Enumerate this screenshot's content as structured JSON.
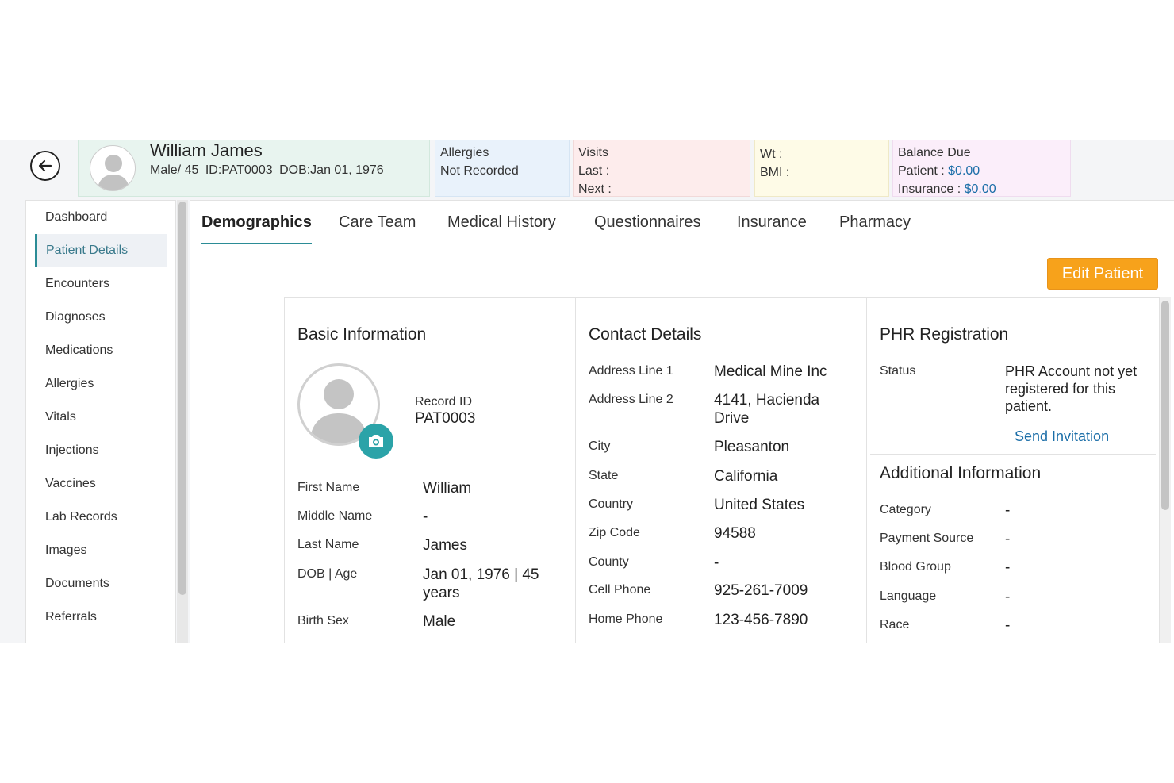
{
  "header": {
    "patient_name": "William James",
    "patient_meta": [
      "Male/ 45",
      "ID:PAT0003",
      "DOB:Jan 01, 1976"
    ],
    "allergies_label": "Allergies",
    "allergies_value": "Not Recorded",
    "visits_label": "Visits",
    "visits_last": "Last  :",
    "visits_next": "Next :",
    "wt": "Wt   :",
    "bmi": "BMI  :",
    "balance_label": "Balance Due",
    "patient_balance_label": "Patient :",
    "patient_balance_value": "$0.00",
    "insurance_balance_label": "Insurance :",
    "insurance_balance_value": "$0.00"
  },
  "sidebar": {
    "items": [
      {
        "label": "Dashboard",
        "active": false
      },
      {
        "label": "Patient Details",
        "active": true
      },
      {
        "label": "Encounters",
        "active": false
      },
      {
        "label": "Diagnoses",
        "active": false
      },
      {
        "label": "Medications",
        "active": false
      },
      {
        "label": "Allergies",
        "active": false
      },
      {
        "label": "Vitals",
        "active": false
      },
      {
        "label": "Injections",
        "active": false
      },
      {
        "label": "Vaccines",
        "active": false
      },
      {
        "label": "Lab Records",
        "active": false
      },
      {
        "label": "Images",
        "active": false
      },
      {
        "label": "Documents",
        "active": false
      },
      {
        "label": "Referrals",
        "active": false
      }
    ]
  },
  "tabs": [
    "Demographics",
    "Care Team",
    "Medical History",
    "Questionnaires",
    "Insurance",
    "Pharmacy"
  ],
  "active_tab": "Demographics",
  "edit_button": "Edit Patient",
  "basic_info": {
    "title": "Basic Information",
    "record_id_label": "Record ID",
    "record_id_value": "PAT0003",
    "fields": [
      {
        "label": "First Name",
        "value": "William"
      },
      {
        "label": "Middle Name",
        "value": "-"
      },
      {
        "label": "Last Name",
        "value": "James"
      },
      {
        "label": "DOB | Age",
        "value": "Jan 01, 1976 | 45 years"
      },
      {
        "label": "Birth Sex",
        "value": "Male"
      }
    ]
  },
  "contact": {
    "title": "Contact Details",
    "fields": [
      {
        "label": "Address Line 1",
        "value": "Medical Mine Inc"
      },
      {
        "label": "Address Line 2",
        "value": "4141, Hacienda Drive"
      },
      {
        "label": "City",
        "value": "Pleasanton"
      },
      {
        "label": "State",
        "value": "California"
      },
      {
        "label": "Country",
        "value": "United States"
      },
      {
        "label": "Zip Code",
        "value": "94588"
      },
      {
        "label": "County",
        "value": "-"
      },
      {
        "label": "Cell Phone",
        "value": "925-261-7009"
      },
      {
        "label": "Home Phone",
        "value": "123-456-7890"
      }
    ]
  },
  "phr": {
    "title": "PHR Registration",
    "status_label": "Status",
    "status_value": "PHR Account not yet registered for this patient.",
    "send_invitation": "Send Invitation"
  },
  "additional": {
    "title": "Additional Information",
    "fields": [
      {
        "label": "Category",
        "value": "-"
      },
      {
        "label": "Payment Source",
        "value": "-"
      },
      {
        "label": "Blood Group",
        "value": "-"
      },
      {
        "label": "Language",
        "value": "-"
      },
      {
        "label": "Race",
        "value": "-"
      }
    ]
  },
  "colors": {
    "accent": "#2b8c96",
    "edit_button": "#f7a21b",
    "link": "#1b6ea8"
  }
}
